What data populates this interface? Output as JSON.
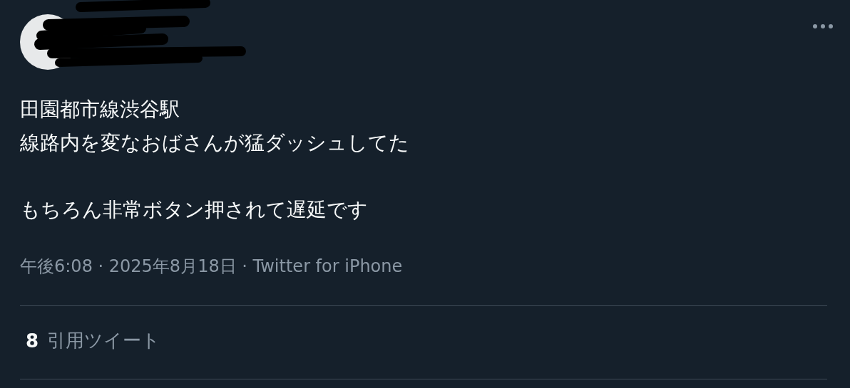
{
  "tweet": {
    "paragraphs": [
      {
        "lines": [
          "田園都市線渋谷駅",
          "線路内を変なおばさんが猛ダッシュしてた"
        ]
      },
      {
        "lines": [
          "もちろん非常ボタン押されて遅延です"
        ]
      }
    ],
    "meta": "午後6:08 · 2025年8月18日 · Twitter for iPhone",
    "quote_count": {
      "count": "8",
      "label": "引用ツイート"
    }
  }
}
